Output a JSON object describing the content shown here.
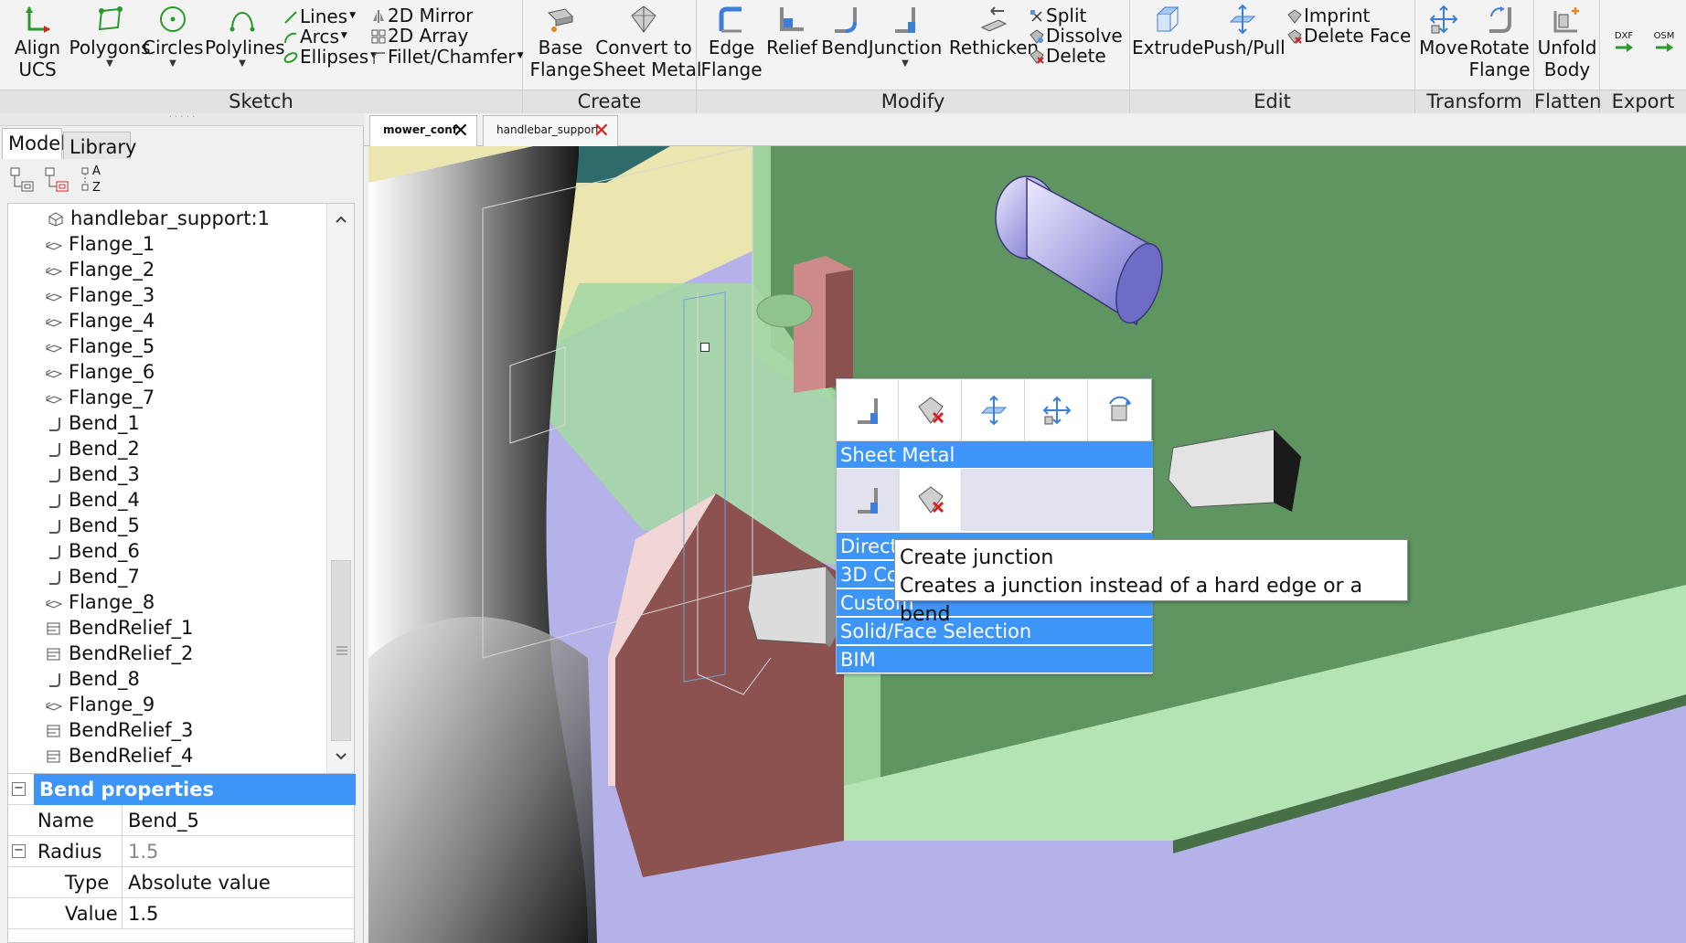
{
  "ribbon": {
    "groups": {
      "sketch": "Sketch",
      "create": "Create",
      "modify": "Modify",
      "edit": "Edit",
      "transform": "Transform",
      "flatten": "Flatten",
      "export": "Export"
    },
    "align_ucs": [
      "Align",
      "UCS"
    ],
    "polygons": "Polygons",
    "circles": "Circles",
    "polylines": "Polylines",
    "lines": "Lines",
    "arcs": "Arcs",
    "ellipses": "Ellipses",
    "mirror2d": "2D Mirror",
    "array2d": "2D Array",
    "fillet": "Fillet/Chamfer",
    "base_flange": [
      "Base",
      "Flange"
    ],
    "convert": [
      "Convert to",
      "Sheet Metal"
    ],
    "edge_flange": [
      "Edge",
      "Flange"
    ],
    "relief": "Relief",
    "bend": "Bend",
    "junction": "Junction",
    "rethicken": "Rethicken",
    "split": "Split",
    "dissolve": "Dissolve",
    "delete": "Delete",
    "extrude": "Extrude",
    "pushpull": "Push/Pull",
    "imprint": "Imprint",
    "delete_face": "Delete Face",
    "move": "Move",
    "rotate_flange": [
      "Rotate",
      "Flange"
    ],
    "unfold_body": [
      "Unfold",
      "Body"
    ],
    "dxf": "DXF",
    "osm": "OSM"
  },
  "panel": {
    "tabs": [
      "Model",
      "Library"
    ],
    "sort_labels": [
      "A",
      "Z"
    ],
    "tree": [
      "handlebar_support:1",
      "Flange_1",
      "Flange_2",
      "Flange_3",
      "Flange_4",
      "Flange_5",
      "Flange_6",
      "Flange_7",
      "Bend_1",
      "Bend_2",
      "Bend_3",
      "Bend_4",
      "Bend_5",
      "Bend_6",
      "Bend_7",
      "Flange_8",
      "BendRelief_1",
      "BendRelief_2",
      "Bend_8",
      "Flange_9",
      "BendRelief_3",
      "BendRelief_4"
    ],
    "properties": {
      "title": "Bend properties",
      "name_label": "Name",
      "name_value": "Bend_5",
      "radius_label": "Radius",
      "radius_value": "1.5",
      "type_label": "Type",
      "type_value": "Absolute value",
      "value_label": "Value",
      "value_value": "1.5"
    }
  },
  "documents": {
    "tabs": [
      "mower_conf",
      "handlebar_support"
    ]
  },
  "quad_menu": {
    "sections": [
      "Sheet Metal",
      "Direct",
      "3D Co",
      "Custom",
      "Solid/Face Selection",
      "BIM"
    ]
  },
  "tooltip": {
    "title": "Create junction",
    "description": "Creates a junction instead of a hard edge or a bend"
  },
  "colors": {
    "accent": "#3d95f7",
    "sheet_green": "#5f9560",
    "sheet_light_green": "#b4e3b4",
    "ground_purple": "#b4b2e8",
    "bend_brown": "#8b5250"
  }
}
